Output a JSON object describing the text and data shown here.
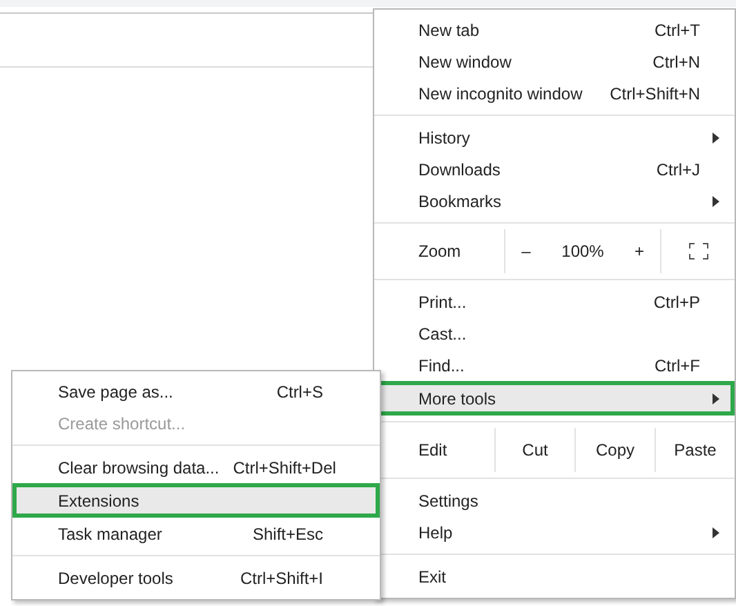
{
  "main_menu": {
    "items": [
      {
        "kind": "item",
        "label": "New tab",
        "shortcut": "Ctrl+T",
        "has_submenu": false,
        "selected": false
      },
      {
        "kind": "item",
        "label": "New window",
        "shortcut": "Ctrl+N",
        "has_submenu": false,
        "selected": false
      },
      {
        "kind": "item",
        "label": "New incognito window",
        "shortcut": "Ctrl+Shift+N",
        "has_submenu": false,
        "selected": false
      },
      {
        "kind": "separator"
      },
      {
        "kind": "item",
        "label": "History",
        "has_submenu": true,
        "selected": false
      },
      {
        "kind": "item",
        "label": "Downloads",
        "shortcut": "Ctrl+J",
        "has_submenu": false,
        "selected": false
      },
      {
        "kind": "item",
        "label": "Bookmarks",
        "has_submenu": true,
        "selected": false
      },
      {
        "kind": "separator"
      },
      {
        "kind": "zoom",
        "label": "Zoom",
        "minus": "–",
        "value": "100%",
        "plus": "+"
      },
      {
        "kind": "separator"
      },
      {
        "kind": "item",
        "label": "Print...",
        "shortcut": "Ctrl+P",
        "has_submenu": false,
        "selected": false
      },
      {
        "kind": "item",
        "label": "Cast...",
        "has_submenu": false,
        "selected": false
      },
      {
        "kind": "item",
        "label": "Find...",
        "shortcut": "Ctrl+F",
        "has_submenu": false,
        "selected": false
      },
      {
        "kind": "item",
        "label": "More tools",
        "has_submenu": true,
        "selected": true
      },
      {
        "kind": "separator"
      },
      {
        "kind": "edit",
        "label": "Edit",
        "actions": [
          "Cut",
          "Copy",
          "Paste"
        ]
      },
      {
        "kind": "separator"
      },
      {
        "kind": "item",
        "label": "Settings",
        "has_submenu": false,
        "selected": false
      },
      {
        "kind": "item",
        "label": "Help",
        "has_submenu": true,
        "selected": false
      },
      {
        "kind": "separator"
      },
      {
        "kind": "item",
        "label": "Exit",
        "has_submenu": false,
        "selected": false
      }
    ]
  },
  "more_tools_menu": {
    "items": [
      {
        "kind": "item",
        "label": "Save page as...",
        "shortcut": "Ctrl+S",
        "disabled": false,
        "selected": false
      },
      {
        "kind": "item",
        "label": "Create shortcut...",
        "disabled": true,
        "selected": false
      },
      {
        "kind": "separator"
      },
      {
        "kind": "item",
        "label": "Clear browsing data...",
        "shortcut": "Ctrl+Shift+Del",
        "disabled": false,
        "selected": false
      },
      {
        "kind": "item",
        "label": "Extensions",
        "disabled": false,
        "selected": true
      },
      {
        "kind": "item",
        "label": "Task manager",
        "shortcut": "Shift+Esc",
        "disabled": false,
        "selected": false
      },
      {
        "kind": "separator"
      },
      {
        "kind": "item",
        "label": "Developer tools",
        "shortcut": "Ctrl+Shift+I",
        "disabled": false,
        "selected": false
      }
    ]
  }
}
